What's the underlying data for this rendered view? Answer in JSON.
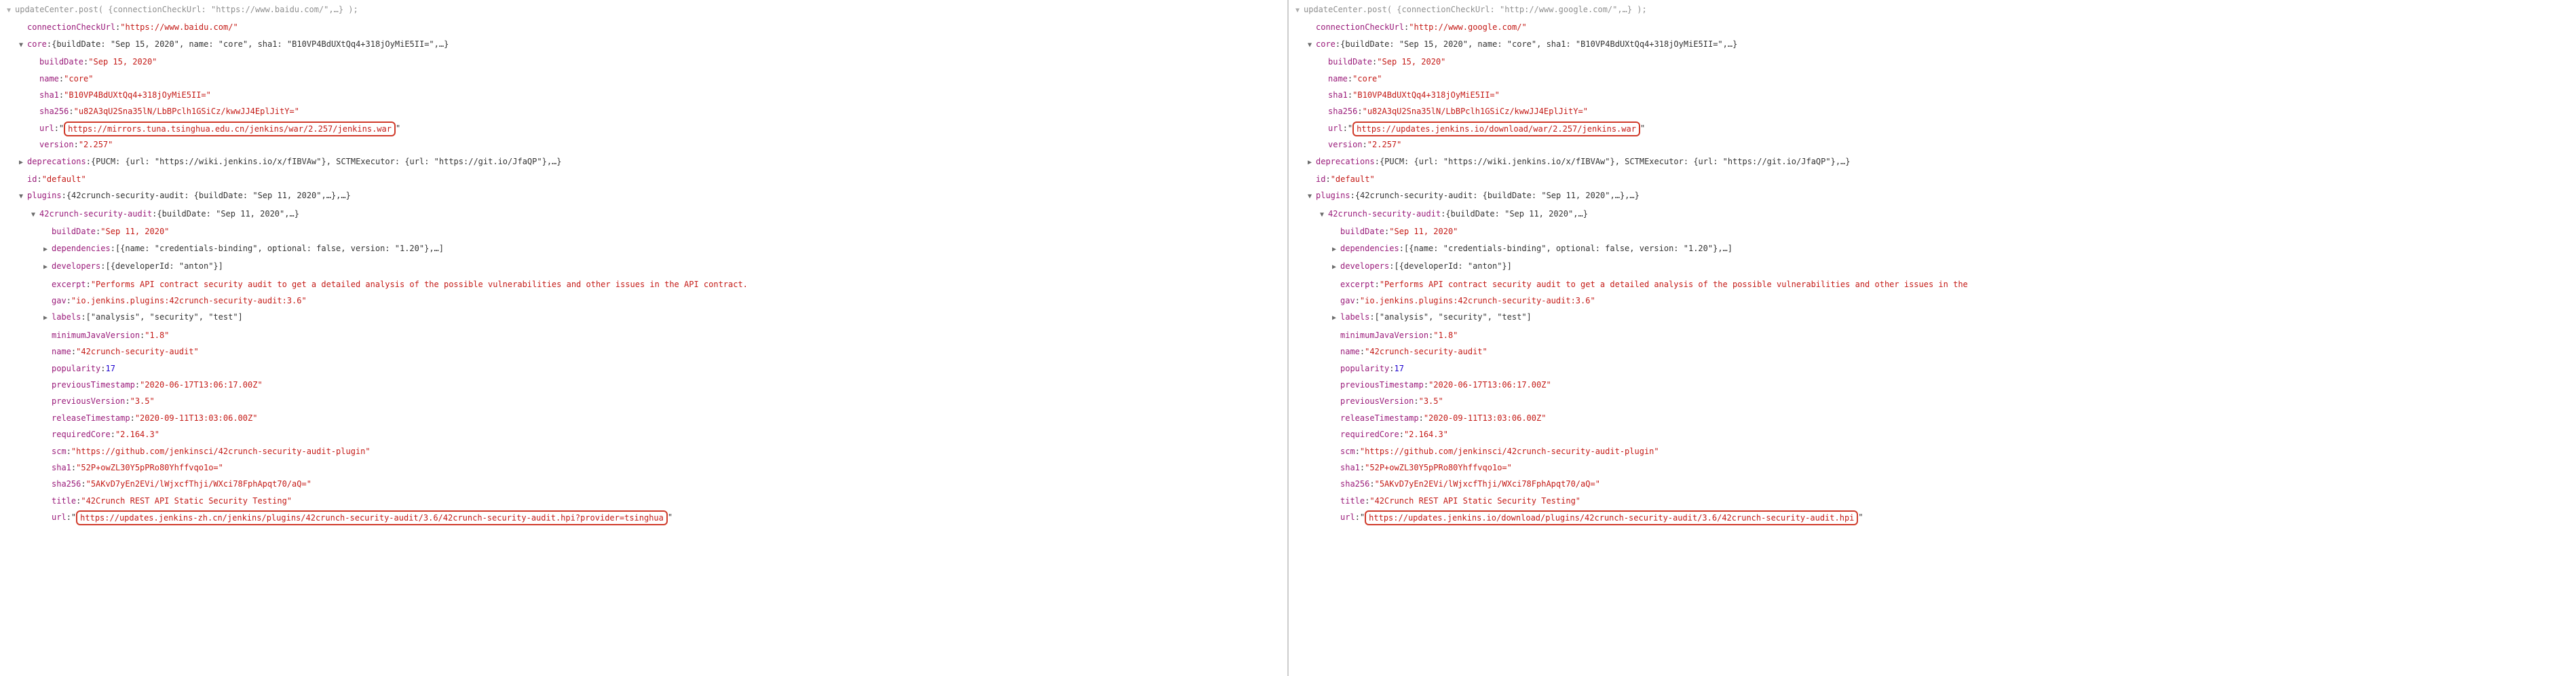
{
  "left": {
    "post_call": "updateCenter.post( {connectionCheckUrl: \"https://www.baidu.com/\",…} );",
    "connectionCheckUrl": "https://www.baidu.com/",
    "core_summary": "{buildDate: \"Sep 15, 2020\", name: \"core\", sha1: \"B10VP4BdUXtQq4+318jOyMiE5II=\",…}",
    "core": {
      "buildDate": "Sep 15, 2020",
      "name": "core",
      "sha1": "B10VP4BdUXtQq4+318jOyMiE5II=",
      "sha256": "u82A3qU2Sna35lN/LbBPclh1GSiCz/kwwJJ4EplJitY=",
      "url": "https://mirrors.tuna.tsinghua.edu.cn/jenkins/war/2.257/jenkins.war",
      "version": "2.257"
    },
    "deprecations": "{PUCM: {url: \"https://wiki.jenkins.io/x/fIBVAw\"}, SCTMExecutor: {url: \"https://git.io/JfaQP\"},…}",
    "id": "default",
    "plugins_summary": "{42crunch-security-audit: {buildDate: \"Sep 11, 2020\",…},…}",
    "plugin_key": "42crunch-security-audit",
    "plugin_summary": "{buildDate: \"Sep 11, 2020\",…}",
    "plugin": {
      "buildDate": "Sep 11, 2020",
      "dependencies": "[{name: \"credentials-binding\", optional: false, version: \"1.20\"},…]",
      "developers": "[{developerId: \"anton\"}]",
      "excerpt": "Performs API contract security audit to get a detailed analysis of the possible vulnerabilities and other issues in the API contract.",
      "gav": "io.jenkins.plugins:42crunch-security-audit:3.6",
      "labels": "[\"analysis\", \"security\", \"test\"]",
      "minimumJavaVersion": "1.8",
      "name": "42crunch-security-audit",
      "popularity": 17,
      "previousTimestamp": "2020-06-17T13:06:17.00Z",
      "previousVersion": "3.5",
      "releaseTimestamp": "2020-09-11T13:03:06.00Z",
      "requiredCore": "2.164.3",
      "scm": "https://github.com/jenkinsci/42crunch-security-audit-plugin",
      "sha1": "52P+owZL30Y5pPRo80Yhffvqo1o=",
      "sha256": "5AKvD7yEn2EVi/lWjxcfThji/WXci78FphApqt70/aQ=",
      "title": "42Crunch REST API Static Security Testing",
      "url": "https://updates.jenkins-zh.cn/jenkins/plugins/42crunch-security-audit/3.6/42crunch-security-audit.hpi?provider=tsinghua"
    }
  },
  "right": {
    "post_call": "updateCenter.post( {connectionCheckUrl: \"http://www.google.com/\",…} );",
    "connectionCheckUrl": "http://www.google.com/",
    "core_summary": "{buildDate: \"Sep 15, 2020\", name: \"core\", sha1: \"B10VP4BdUXtQq4+318jOyMiE5II=\",…}",
    "core": {
      "buildDate": "Sep 15, 2020",
      "name": "core",
      "sha1": "B10VP4BdUXtQq4+318jOyMiE5II=",
      "sha256": "u82A3qU2Sna35lN/LbBPclh1GSiCz/kwwJJ4EplJitY=",
      "url": "https://updates.jenkins.io/download/war/2.257/jenkins.war",
      "version": "2.257"
    },
    "deprecations": "{PUCM: {url: \"https://wiki.jenkins.io/x/fIBVAw\"}, SCTMExecutor: {url: \"https://git.io/JfaQP\"},…}",
    "id": "default",
    "plugins_summary": "{42crunch-security-audit: {buildDate: \"Sep 11, 2020\",…},…}",
    "plugin_key": "42crunch-security-audit",
    "plugin_summary": "{buildDate: \"Sep 11, 2020\",…}",
    "plugin": {
      "buildDate": "Sep 11, 2020",
      "dependencies": "[{name: \"credentials-binding\", optional: false, version: \"1.20\"},…]",
      "developers": "[{developerId: \"anton\"}]",
      "excerpt": "Performs API contract security audit to get a detailed analysis of the possible vulnerabilities and other issues in the",
      "gav": "io.jenkins.plugins:42crunch-security-audit:3.6",
      "labels": "[\"analysis\", \"security\", \"test\"]",
      "minimumJavaVersion": "1.8",
      "name": "42crunch-security-audit",
      "popularity": 17,
      "previousTimestamp": "2020-06-17T13:06:17.00Z",
      "previousVersion": "3.5",
      "releaseTimestamp": "2020-09-11T13:03:06.00Z",
      "requiredCore": "2.164.3",
      "scm": "https://github.com/jenkinsci/42crunch-security-audit-plugin",
      "sha1": "52P+owZL30Y5pPRo80Yhffvqo1o=",
      "sha256": "5AKvD7yEn2EVi/lWjxcfThji/WXci78FphApqt70/aQ=",
      "title": "42Crunch REST API Static Security Testing",
      "url": "https://updates.jenkins.io/download/plugins/42crunch-security-audit/3.6/42crunch-security-audit.hpi"
    }
  }
}
